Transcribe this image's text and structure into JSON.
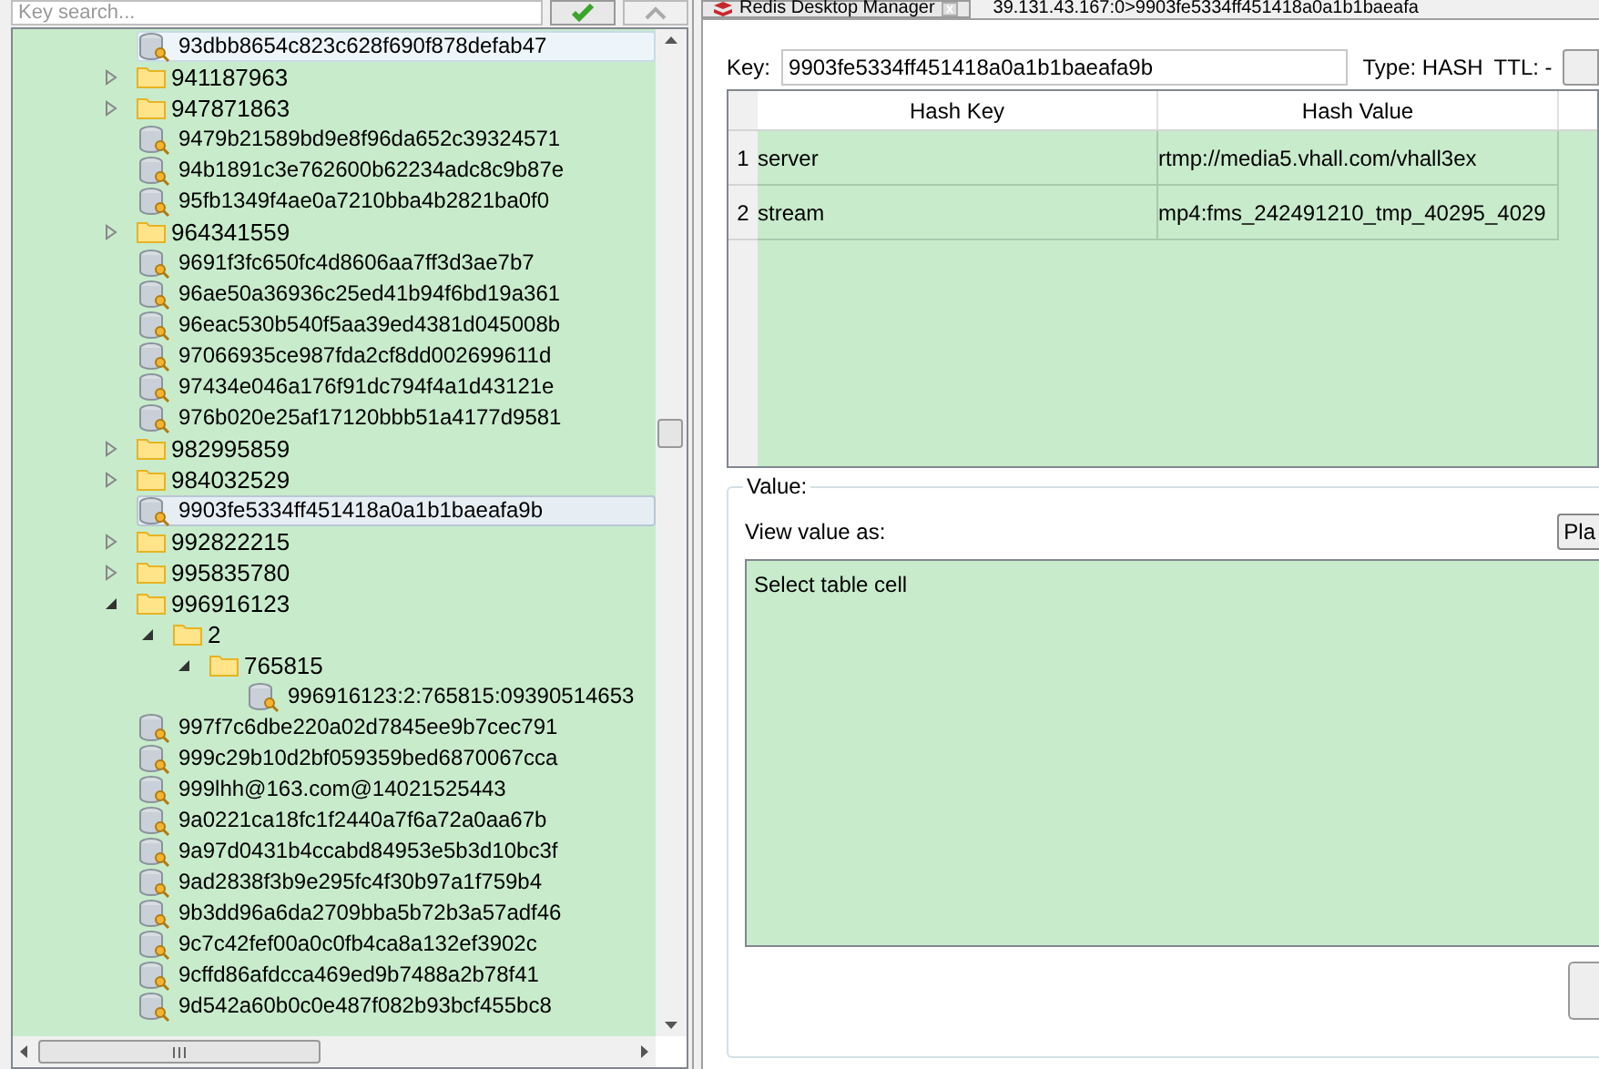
{
  "search": {
    "placeholder": "Key search..."
  },
  "tree": [
    {
      "kind": "key",
      "label": "93dbb8654c823c628f690f878defab47",
      "selected": false,
      "hovered": true
    },
    {
      "kind": "folder",
      "label": "941187963",
      "expanded": false
    },
    {
      "kind": "folder",
      "label": "947871863",
      "expanded": false
    },
    {
      "kind": "key",
      "label": "9479b21589bd9e8f96da652c39324571",
      "selected": false,
      "hovered": false
    },
    {
      "kind": "key",
      "label": "94b1891c3e762600b62234adc8c9b87e",
      "selected": false,
      "hovered": false
    },
    {
      "kind": "key",
      "label": "95fb1349f4ae0a7210bba4b2821ba0f0",
      "selected": false,
      "hovered": false
    },
    {
      "kind": "folder",
      "label": "964341559",
      "expanded": false
    },
    {
      "kind": "key",
      "label": "9691f3fc650fc4d8606aa7ff3d3ae7b7",
      "selected": false,
      "hovered": false
    },
    {
      "kind": "key",
      "label": "96ae50a36936c25ed41b94f6bd19a361",
      "selected": false,
      "hovered": false
    },
    {
      "kind": "key",
      "label": "96eac530b540f5aa39ed4381d045008b",
      "selected": false,
      "hovered": false
    },
    {
      "kind": "key",
      "label": "97066935ce987fda2cf8dd002699611d",
      "selected": false,
      "hovered": false
    },
    {
      "kind": "key",
      "label": "97434e046a176f91dc794f4a1d43121e",
      "selected": false,
      "hovered": false
    },
    {
      "kind": "key",
      "label": "976b020e25af17120bbb51a4177d9581",
      "selected": false,
      "hovered": false
    },
    {
      "kind": "folder",
      "label": "982995859",
      "expanded": false
    },
    {
      "kind": "folder",
      "label": "984032529",
      "expanded": false
    },
    {
      "kind": "key",
      "label": "9903fe5334ff451418a0a1b1baeafa9b",
      "selected": true,
      "hovered": false
    },
    {
      "kind": "folder",
      "label": "992822215",
      "expanded": false
    },
    {
      "kind": "folder",
      "label": "995835780",
      "expanded": false
    },
    {
      "kind": "folder",
      "label": "996916123",
      "expanded": true,
      "children": [
        {
          "kind": "folder",
          "label": "2",
          "expanded": true,
          "children": [
            {
              "kind": "folder",
              "label": "765815",
              "expanded": true,
              "children": [
                {
                  "kind": "key",
                  "label": "996916123:2:765815:09390514653",
                  "selected": false,
                  "hovered": false
                }
              ]
            }
          ]
        }
      ]
    },
    {
      "kind": "key",
      "label": "997f7c6dbe220a02d7845ee9b7cec791",
      "selected": false,
      "hovered": false
    },
    {
      "kind": "key",
      "label": "999c29b10d2bf059359bed6870067cca",
      "selected": false,
      "hovered": false
    },
    {
      "kind": "key",
      "label": "999lhh@163.com@14021525443",
      "selected": false,
      "hovered": false
    },
    {
      "kind": "key",
      "label": "9a0221ca18fc1f2440a7f6a72a0aa67b",
      "selected": false,
      "hovered": false
    },
    {
      "kind": "key",
      "label": "9a97d0431b4ccabd84953e5b3d10bc3f",
      "selected": false,
      "hovered": false
    },
    {
      "kind": "key",
      "label": "9ad2838f3b9e295fc4f30b97a1f759b4",
      "selected": false,
      "hovered": false
    },
    {
      "kind": "key",
      "label": "9b3dd96a6da2709bba5b72b3a57adf46",
      "selected": false,
      "hovered": false
    },
    {
      "kind": "key",
      "label": "9c7c42fef00a0c0fb4ca8a132ef3902c",
      "selected": false,
      "hovered": false
    },
    {
      "kind": "key",
      "label": "9cffd86afdcca469ed9b7488a2b78f41",
      "selected": false,
      "hovered": false
    },
    {
      "kind": "key",
      "label": "9d542a60b0c0e487f082b93bcf455bc8",
      "selected": false,
      "hovered": false
    }
  ],
  "tab": {
    "label": "Redis Desktop Manager"
  },
  "address": "39.131.43.167:0>9903fe5334ff451418a0a1b1baeafa",
  "key_bar": {
    "label": "Key:",
    "value": "9903fe5334ff451418a0a1b1baeafa9b",
    "type_label": "Type: HASH",
    "ttl_label": "TTL: -"
  },
  "table": {
    "columns": [
      "Hash Key",
      "Hash Value"
    ],
    "rows": [
      {
        "index": "1",
        "key": "server",
        "value": "rtmp://media5.vhall.com/vhall3ex"
      },
      {
        "index": "2",
        "key": "stream",
        "value": "mp4:fms_242491210_tmp_40295_4029"
      }
    ]
  },
  "value_panel": {
    "legend": "Value:",
    "view_label": "View value as:",
    "view_button": "Pla",
    "text": "Select table cell"
  }
}
